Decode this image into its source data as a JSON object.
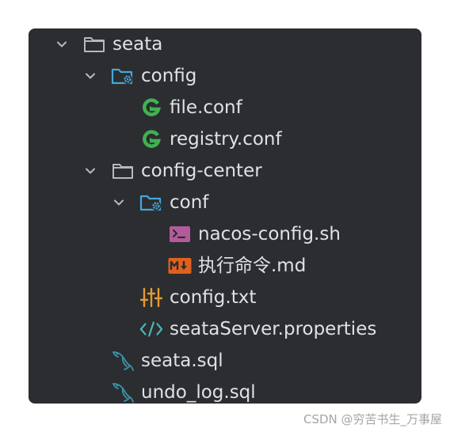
{
  "project_tree": {
    "items": [
      {
        "label": "seata",
        "icon": "folder-icon",
        "expanded": true
      },
      {
        "label": "config",
        "icon": "config-folder-icon",
        "expanded": true
      },
      {
        "label": "file.conf",
        "icon": "hocon-file-icon"
      },
      {
        "label": "registry.conf",
        "icon": "hocon-file-icon"
      },
      {
        "label": "config-center",
        "icon": "folder-icon",
        "expanded": true
      },
      {
        "label": "conf",
        "icon": "config-folder-icon",
        "expanded": true
      },
      {
        "label": "nacos-config.sh",
        "icon": "shell-script-icon"
      },
      {
        "label": "执行命令.md",
        "icon": "markdown-icon"
      },
      {
        "label": "config.txt",
        "icon": "settings-sliders-icon"
      },
      {
        "label": "seataServer.properties",
        "icon": "code-brackets-icon"
      },
      {
        "label": "seata.sql",
        "icon": "mysql-dolphin-icon"
      },
      {
        "label": "undo_log.sql",
        "icon": "mysql-dolphin-icon"
      }
    ]
  },
  "watermark": "CSDN @穷苦书生_万事屋",
  "colors": {
    "panel_bg": "#2b2d30",
    "text": "#dfe1e5",
    "hocon_green": "#3fb24f",
    "config_blue": "#45a8d8",
    "shell_purple": "#b35b9a",
    "markdown_orange": "#e0601e",
    "sliders_orange": "#e69a2e",
    "properties_teal": "#4ab5b8",
    "mysql_teal": "#3d93a8"
  }
}
